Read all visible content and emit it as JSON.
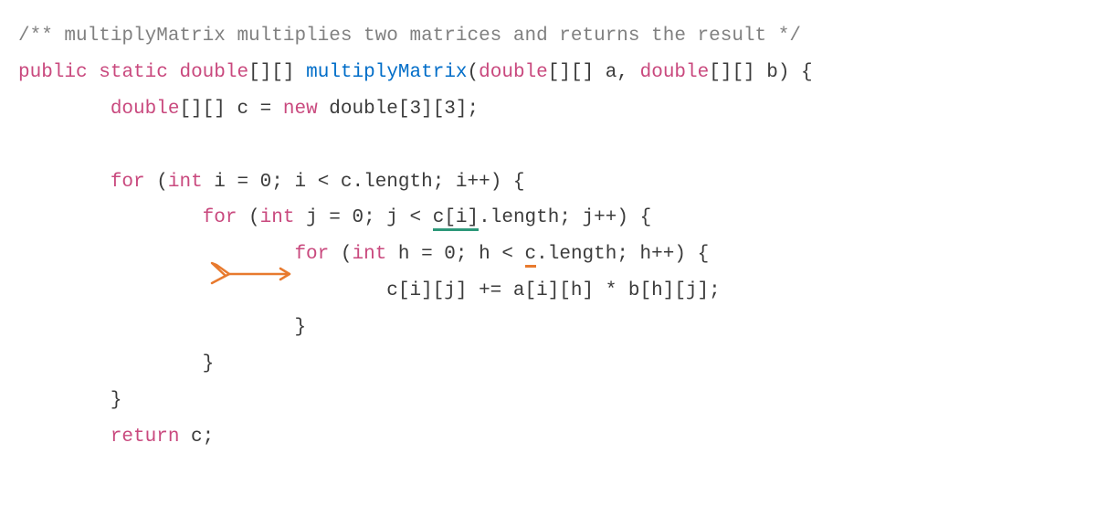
{
  "code": {
    "comment": "/** multiplyMatrix multiplies two matrices and returns the result */",
    "line2": {
      "public": "public",
      "static": "static",
      "returntype": "double",
      "brackets1": "[][] ",
      "method": "multiplyMatrix",
      "lparen": "(",
      "ptype1": "double",
      "pbrackets1": "[][] a, ",
      "ptype2": "double",
      "pbrackets2": "[][] b) {"
    },
    "line3": {
      "indent": "        ",
      "type": "double",
      "rest1": "[][] c = ",
      "new": "new",
      "rest2": " double[3][3];"
    },
    "line5": {
      "indent": "        ",
      "for": "for",
      "rest1": " (",
      "int": "int",
      "rest2": " i = 0; i < c.length; i++) {"
    },
    "line6": {
      "indent": "                ",
      "for": "for",
      "rest1": " (",
      "int": "int",
      "rest2": " j = 0; j < ",
      "underlined": "c[i]",
      "rest3": ".length; j++) {"
    },
    "line7": {
      "indent": "                        ",
      "for": "for",
      "rest1": " (",
      "int": "int",
      "rest2": " h = 0; h < ",
      "underlined": "c",
      "rest3": ".length; h++) {"
    },
    "line8": {
      "indent": "                                ",
      "text": "c[i][j] += a[i][h] * b[h][j];"
    },
    "line9": {
      "indent": "                        ",
      "text": "}"
    },
    "line10": {
      "indent": "                ",
      "text": "}"
    },
    "line11": {
      "indent": "        ",
      "text": "}"
    },
    "line12": {
      "indent": "        ",
      "return": "return",
      "rest": " c;"
    }
  }
}
